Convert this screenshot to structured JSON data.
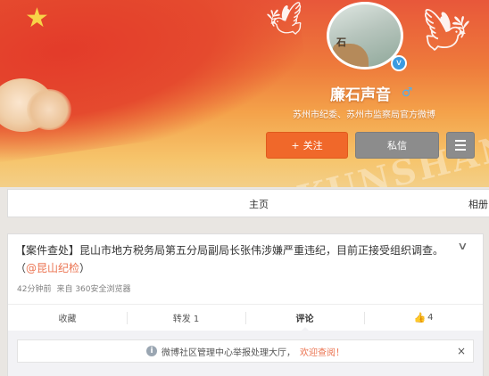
{
  "profile": {
    "name": "廉石声音",
    "gender_symbol": "♂",
    "description": "苏州市纪委、苏州市监察局官方微博",
    "avatar_text": "石",
    "verified_symbol": "v"
  },
  "banner": {
    "watermark": "昆山论坛 KUNSHAN BBS"
  },
  "buttons": {
    "follow_label": "关注",
    "follow_icon": "+",
    "message_label": "私信"
  },
  "tabs": {
    "home": "主页",
    "photos": "相册"
  },
  "post": {
    "text_main": "【案件查处】昆山市地方税务局第五分局副局长张伟涉嫌严重违纪，目前正接受组织调查。（",
    "mention": "@昆山纪检",
    "text_end": "）",
    "time": "42分钟前",
    "source": "来自 360安全浏览器",
    "actions": {
      "collect": "收藏",
      "repost": "转发 1",
      "comment": "评论",
      "like_count": "4"
    }
  },
  "notice": {
    "text": "微博社区管理中心举报处理大厅，",
    "link": "欢迎查阅",
    "link_suffix": "！",
    "close": "×"
  },
  "colors": {
    "accent": "#eb7350",
    "follow_button": "#f0682a",
    "gray_button": "#8c8c8c"
  }
}
